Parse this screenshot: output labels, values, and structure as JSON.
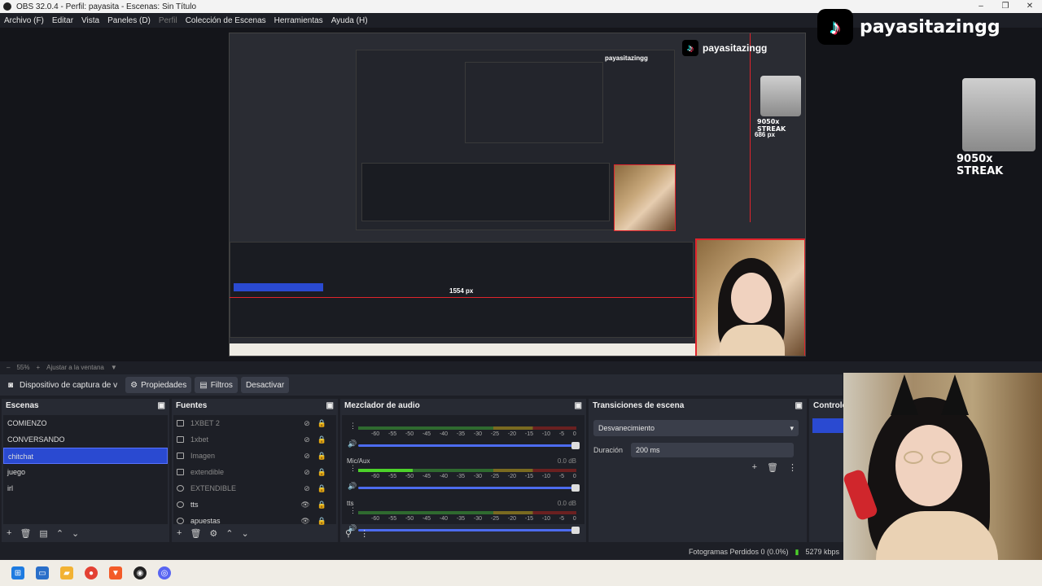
{
  "window": {
    "title": "OBS 32.0.4 - Perfil: payasita - Escenas: Sin Título",
    "controls": [
      "–",
      "❐",
      "✕"
    ]
  },
  "menu": [
    "Archivo (F)",
    "Editar",
    "Vista",
    "Paneles (D)",
    "Perfil",
    "Colección de Escenas",
    "Herramientas",
    "Ayuda (H)"
  ],
  "overlay": {
    "tiktok_name": "payasitazingg",
    "streak": "9050x STREAK",
    "preview_tiktok_name": "payasitazingg",
    "preview_streak": "9050x STREAK",
    "px_label_v": "686 px",
    "px_label_h": "1554 px"
  },
  "zoombar": {
    "zoom": "55%",
    "fit": "Ajustar a la ventana"
  },
  "source_bar": {
    "device": "Dispositivo de captura de v",
    "properties": "Propiedades",
    "filters": "Filtros",
    "deactivate": "Desactivar"
  },
  "scenes": {
    "title": "Escenas",
    "items": [
      "COMIENZO",
      "CONVERSANDO",
      "chitchat",
      "juego",
      "irl"
    ],
    "selected": "chitchat"
  },
  "sources": {
    "title": "Fuentes",
    "items": [
      {
        "name": "1XBET 2",
        "dim": true
      },
      {
        "name": "1xbet",
        "dim": true
      },
      {
        "name": "Imagen",
        "dim": true
      },
      {
        "name": "extendible",
        "dim": true
      },
      {
        "name": "EXTENDIBLE",
        "dim": true
      },
      {
        "name": "tts",
        "dim": false
      },
      {
        "name": "apuestas",
        "dim": false
      }
    ]
  },
  "mixer": {
    "title": "Mezclador de audio",
    "ticks": [
      "-60",
      "-55",
      "-50",
      "-45",
      "-40",
      "-35",
      "-30",
      "-25",
      "-20",
      "-15",
      "-10",
      "-5",
      "0"
    ],
    "channels": [
      {
        "name": "",
        "db": "",
        "level": 0.0
      },
      {
        "name": "Mic/Aux",
        "db": "0.0 dB",
        "level": 0.25
      },
      {
        "name": "tts",
        "db": "0.0 dB",
        "level": 0.0
      }
    ]
  },
  "transitions": {
    "title": "Transiciones de escena",
    "selected": "Desvanecimiento",
    "duration_label": "Duración",
    "duration_value": "200 ms"
  },
  "controls": {
    "title": "Controle"
  },
  "status": {
    "dropped": "Fotogramas Perdidos 0 (0.0%)",
    "bitrate": "5279 kbps"
  },
  "colors": {
    "accent": "#2a4ad1",
    "red_guide": "#e0242c",
    "meter_green": "#4cd12a"
  }
}
